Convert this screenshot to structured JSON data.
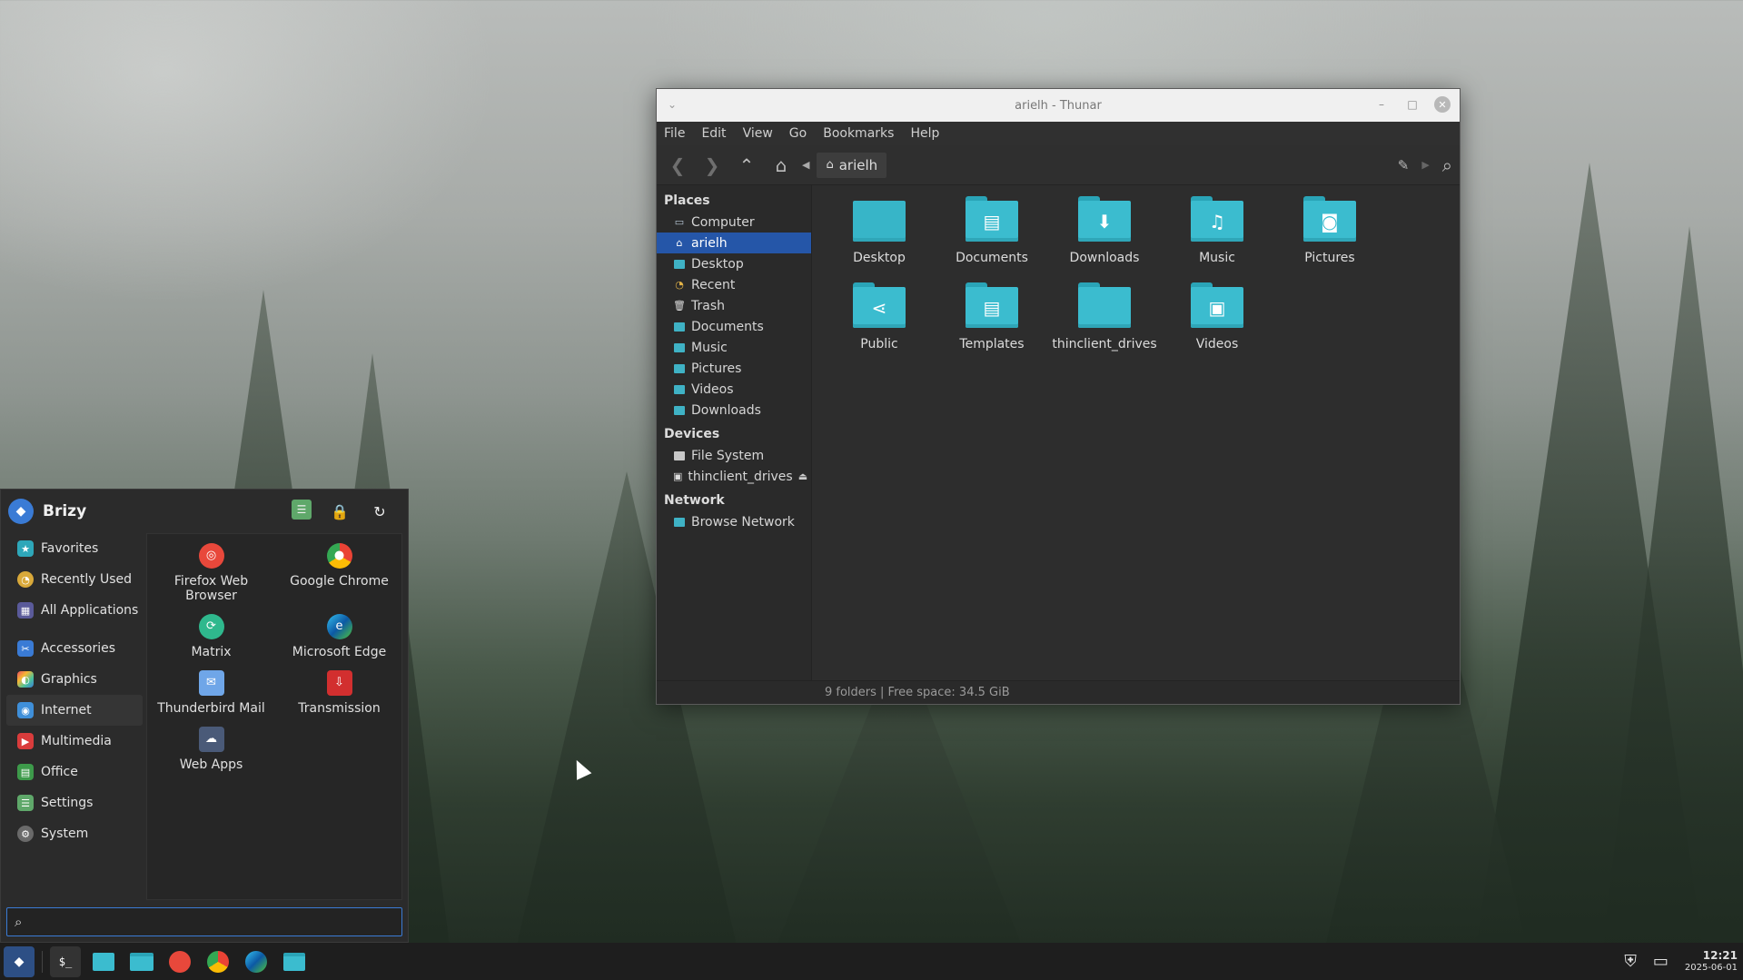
{
  "thunar": {
    "title": "arielh - Thunar",
    "menu": [
      "File",
      "Edit",
      "View",
      "Go",
      "Bookmarks",
      "Help"
    ],
    "path": "arielh",
    "places_heading": "Places",
    "places": [
      "Computer",
      "arielh",
      "Desktop",
      "Recent",
      "Trash",
      "Documents",
      "Music",
      "Pictures",
      "Videos",
      "Downloads"
    ],
    "devices_heading": "Devices",
    "devices": [
      "File System",
      "thinclient_drives"
    ],
    "network_heading": "Network",
    "network": [
      "Browse Network"
    ],
    "files": [
      "Desktop",
      "Documents",
      "Downloads",
      "Music",
      "Pictures",
      "Public",
      "Templates",
      "thinclient_drives",
      "Videos"
    ],
    "status": "9 folders  |  Free space: 34.5 GiB"
  },
  "brizy": {
    "title": "Brizy",
    "categories": [
      "Favorites",
      "Recently Used",
      "All Applications",
      "Accessories",
      "Graphics",
      "Internet",
      "Multimedia",
      "Office",
      "Settings",
      "System"
    ],
    "apps": [
      "Firefox Web Browser",
      "Google Chrome",
      "Matrix",
      "Microsoft Edge",
      "Thunderbird Mail",
      "Transmission",
      "Web Apps"
    ],
    "search_value": ""
  },
  "taskbar": {
    "time": "12:21",
    "date": "2025-06-01"
  },
  "colors": {
    "selection": "#2556a8",
    "folder": "#3bbccf",
    "accent": "#3a7bd5"
  }
}
